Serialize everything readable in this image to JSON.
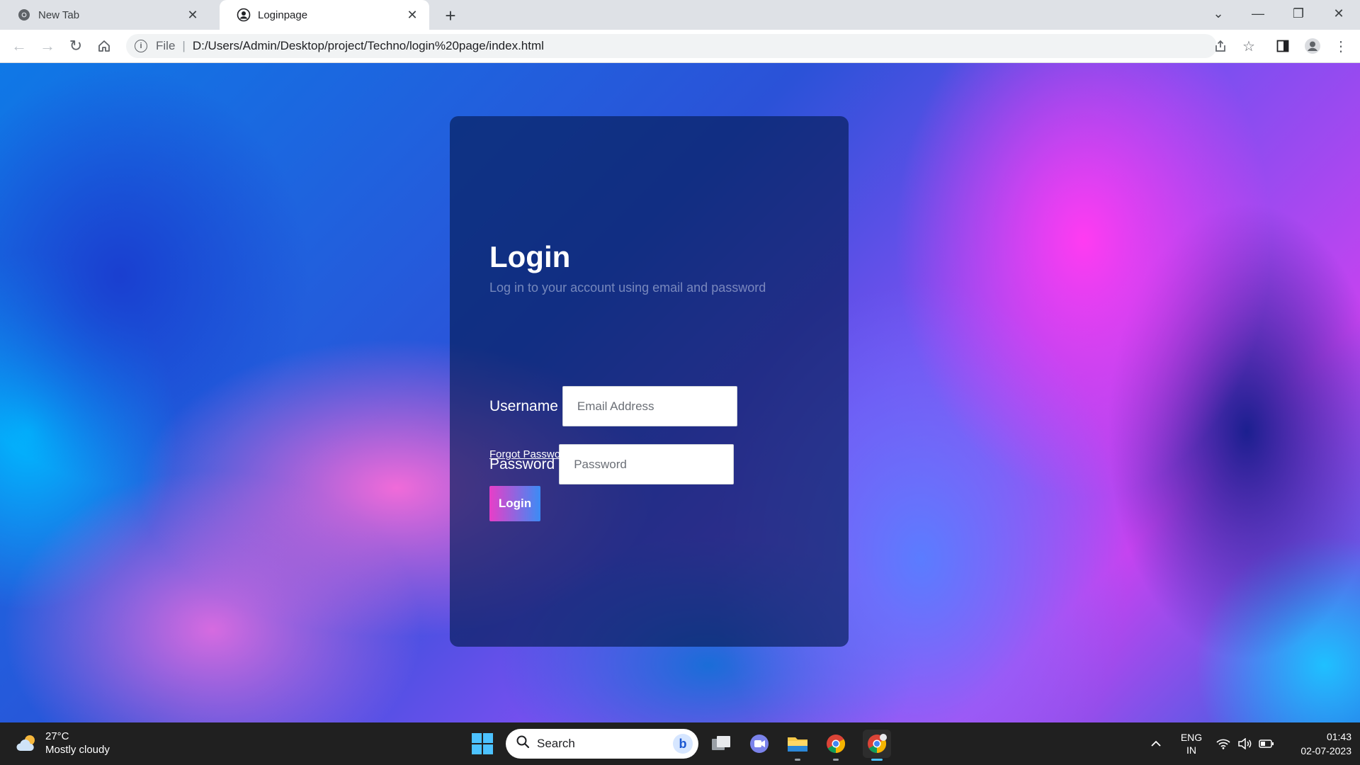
{
  "browser": {
    "tabs": [
      {
        "title": "New Tab",
        "active": false
      },
      {
        "title": "Loginpage",
        "active": true
      }
    ],
    "address": {
      "scheme": "File",
      "url": "D:/Users/Admin/Desktop/project/Techno/login%20page/index.html"
    }
  },
  "page": {
    "title": "Login",
    "subtitle": "Log in to your account using email and password",
    "username": {
      "label": "Username",
      "placeholder": "Email Address"
    },
    "password": {
      "label": "Password",
      "placeholder": "Password"
    },
    "forgot_label": "Forgot Password",
    "login_label": "Login"
  },
  "taskbar": {
    "weather": {
      "temp": "27°C",
      "desc": "Mostly cloudy"
    },
    "search_placeholder": "Search",
    "lang": {
      "line1": "ENG",
      "line2": "IN"
    },
    "time": "01:43",
    "date": "02-07-2023"
  },
  "colors": {
    "accent_start": "#e83ec8",
    "accent_end": "#3b8cf5",
    "win_blue": "#4cc2ff"
  }
}
